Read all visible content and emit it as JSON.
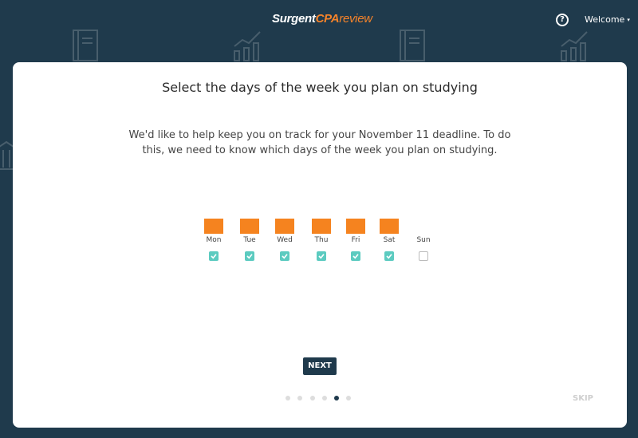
{
  "header": {
    "logo": {
      "part1": "Surgent",
      "part2": "CPA",
      "part3": "review"
    },
    "help_glyph": "?",
    "welcome_label": "Welcome",
    "caret": "▾"
  },
  "background_icons": [
    "notebook-icon",
    "chart-icon",
    "notebook-icon",
    "chart-icon",
    "bank-icon"
  ],
  "card": {
    "title": "Select the days of the week you plan on studying",
    "description": "We'd like to help keep you on track for your November 11 deadline. To do this, we need to know which days of the week you plan on studying.",
    "days": [
      {
        "label": "Mon",
        "checked": true
      },
      {
        "label": "Tue",
        "checked": true
      },
      {
        "label": "Wed",
        "checked": true
      },
      {
        "label": "Thu",
        "checked": true
      },
      {
        "label": "Fri",
        "checked": true
      },
      {
        "label": "Sat",
        "checked": true
      },
      {
        "label": "Sun",
        "checked": false
      }
    ],
    "next_label": "NEXT",
    "skip_label": "SKIP",
    "progress": {
      "total_steps": 6,
      "current_step": 5
    }
  },
  "colors": {
    "background": "#1f3a4c",
    "accent_orange": "#f5831f",
    "checkbox_teal": "#5ccbc0",
    "button": "#1f3a4c"
  }
}
